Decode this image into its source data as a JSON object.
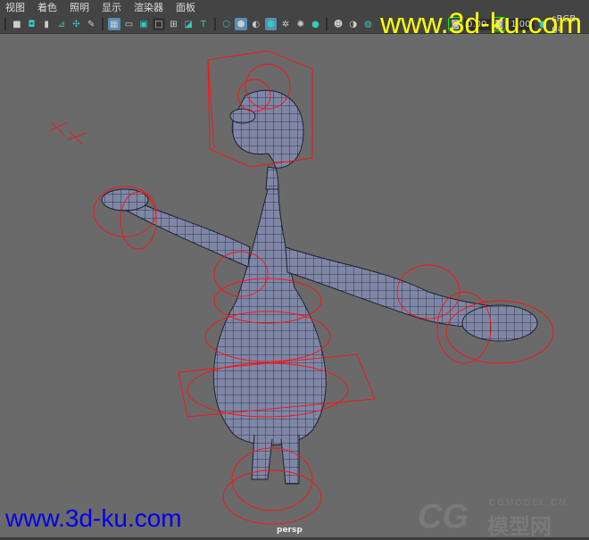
{
  "menu": [
    "视图",
    "着色",
    "照明",
    "显示",
    "渲染器",
    "面板"
  ],
  "toolbar": {
    "icons": [
      "camera-icon",
      "camera-attr-icon",
      "bookmark-icon",
      "image-plane-icon",
      "2d-pan-icon",
      "grease-pencil-icon",
      "grid-icon",
      "film-gate-icon",
      "resolution-gate-icon",
      "gate-mask-icon",
      "field-chart-icon",
      "safe-action-icon",
      "safe-title-icon",
      "wireframe-icon",
      "smooth-shade-icon",
      "default-material-icon",
      "wireframe-on-shaded-icon",
      "textured-icon",
      "lights-icon",
      "shadows-icon",
      "ambient-occlusion-icon",
      "xray-icon",
      "isolate-icon"
    ],
    "exposure": "0.00",
    "gamma": "1.00",
    "colorspace": "sRGB ga"
  },
  "viewport": {
    "camera_label": "persp",
    "background": "#6a6a6a",
    "mesh_color": "#7f87a6",
    "rig_color": "#ff1010"
  },
  "watermarks": {
    "top": "www.3d-ku.com",
    "bottom": "www.3d-ku.com",
    "cg_logo": "CG",
    "cg_site": "CGMODEL.CN",
    "cg_cn": "模型网"
  }
}
